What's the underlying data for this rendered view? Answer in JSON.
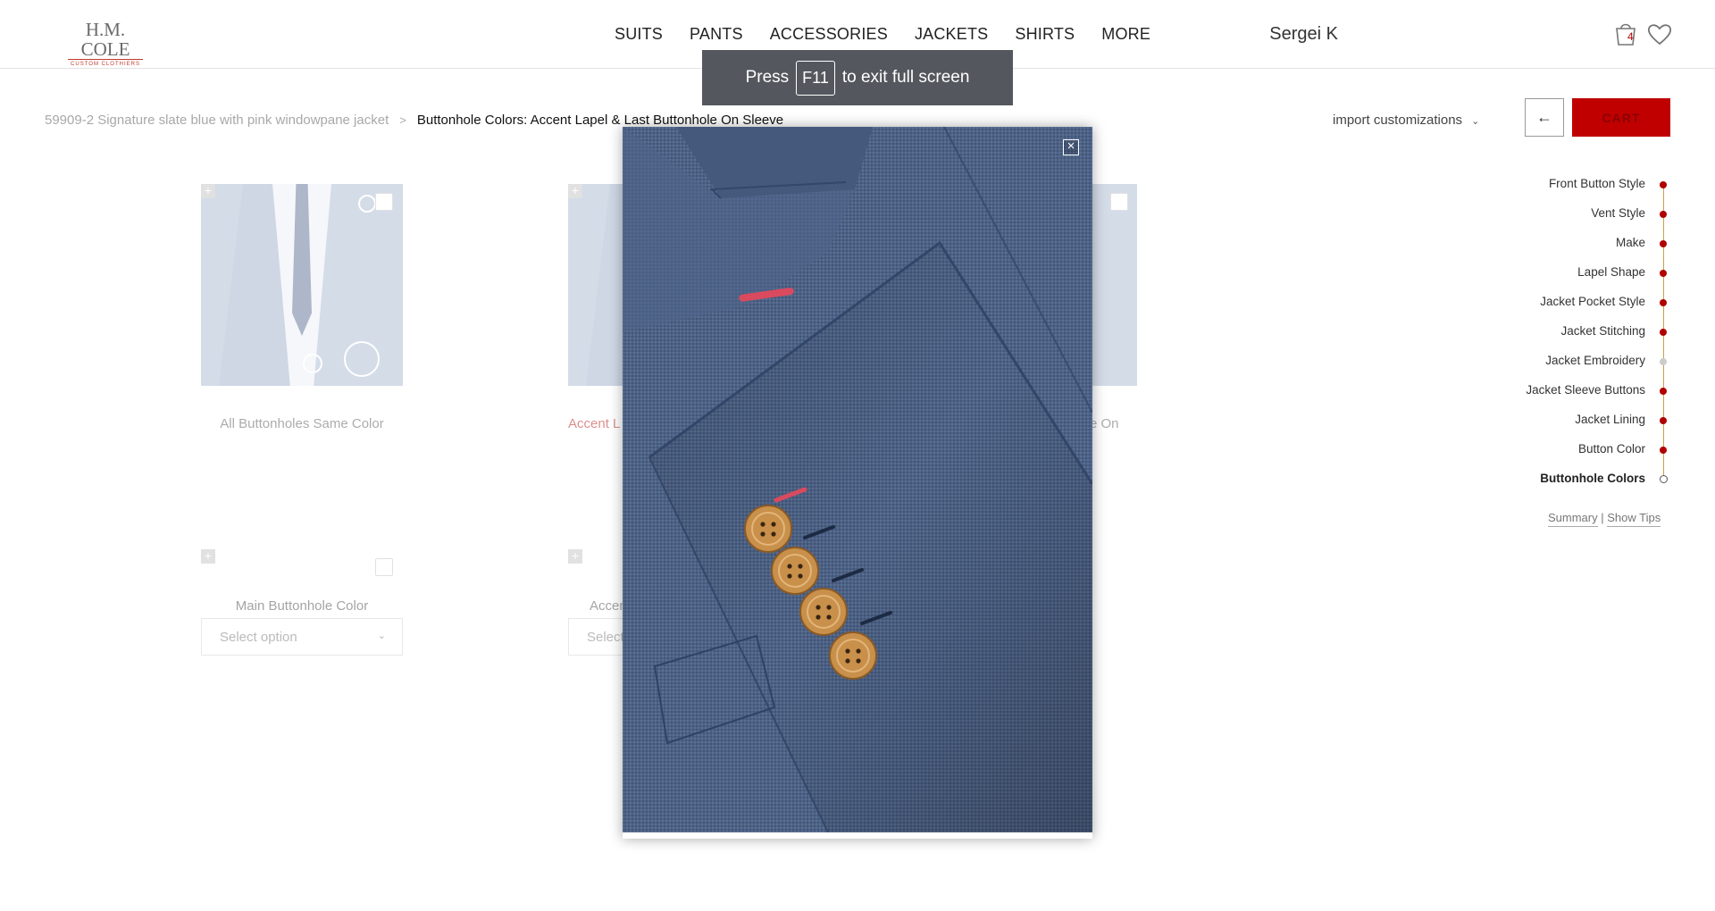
{
  "header": {
    "logo_main": "H.M. COLE",
    "logo_sub": "CUSTOM CLOTHIERS",
    "nav": [
      "SUITS",
      "PANTS",
      "ACCESSORIES",
      "JACKETS",
      "SHIRTS",
      "MORE"
    ],
    "user_name": "Sergei K",
    "cart_count": "4"
  },
  "breadcrumb": {
    "parent": "59909-2 Signature slate blue with pink windowpane jacket",
    "separator": ">",
    "current": "Buttonhole Colors: Accent Lapel & Last Buttonhole On Sleeve"
  },
  "toolbar": {
    "import_label": "import customizations",
    "back_label": "←",
    "cart_label": "CART"
  },
  "options": [
    {
      "label": "All Buttonholes Same Color"
    },
    {
      "label": "Accent L"
    },
    {
      "label": "e On"
    }
  ],
  "selects": [
    {
      "title": "Main Buttonhole Color",
      "placeholder": "Select option"
    },
    {
      "title": "Accen",
      "placeholder": "Select"
    }
  ],
  "progress": {
    "items": [
      {
        "label": "Front Button Style",
        "state": "done"
      },
      {
        "label": "Vent Style",
        "state": "done"
      },
      {
        "label": "Make",
        "state": "done"
      },
      {
        "label": "Lapel Shape",
        "state": "done"
      },
      {
        "label": "Jacket Pocket Style",
        "state": "done"
      },
      {
        "label": "Jacket Stitching",
        "state": "done"
      },
      {
        "label": "Jacket Embroidery",
        "state": "skipped"
      },
      {
        "label": "Jacket Sleeve Buttons",
        "state": "done"
      },
      {
        "label": "Jacket Lining",
        "state": "done"
      },
      {
        "label": "Button Color",
        "state": "done"
      },
      {
        "label": "Buttonhole Colors",
        "state": "current"
      }
    ],
    "summary_label": "Summary",
    "links_sep": "|",
    "tips_label": "Show Tips"
  },
  "fullscreen_toast": {
    "before": "Press",
    "key": "F11",
    "after": "to exit full screen"
  },
  "lightbox": {
    "close_label": "×"
  },
  "colors": {
    "accent": "#b00000",
    "fabric": "#4b5f80",
    "buttonhole_accent": "#d94a5e",
    "button": "#c8904a"
  }
}
